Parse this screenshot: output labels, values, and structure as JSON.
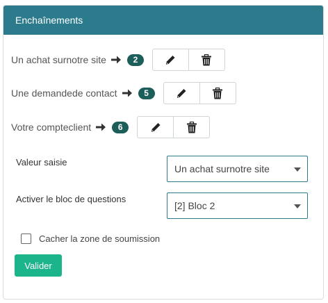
{
  "panel": {
    "title": "Enchaînements"
  },
  "rules": [
    {
      "label": "Un achat surnotre site",
      "count": "2"
    },
    {
      "label": "Une demandede contact",
      "count": "5"
    },
    {
      "label": "Votre compteclient",
      "count": "6"
    }
  ],
  "form": {
    "valeur_label": "Valeur saisie",
    "valeur_selected": "Un achat surnotre site",
    "bloc_label": "Activer le bloc de questions",
    "bloc_selected": "[2] Bloc 2",
    "hide_label": "Cacher la zone de soumission",
    "hide_checked": false,
    "submit_label": "Valider"
  },
  "colors": {
    "header": "#2b7b8c",
    "badge": "#1c5e59",
    "submit": "#1cb48b"
  },
  "icons": {
    "arrow": "arrow-right-icon",
    "edit": "pencil-icon",
    "delete": "trash-icon"
  }
}
